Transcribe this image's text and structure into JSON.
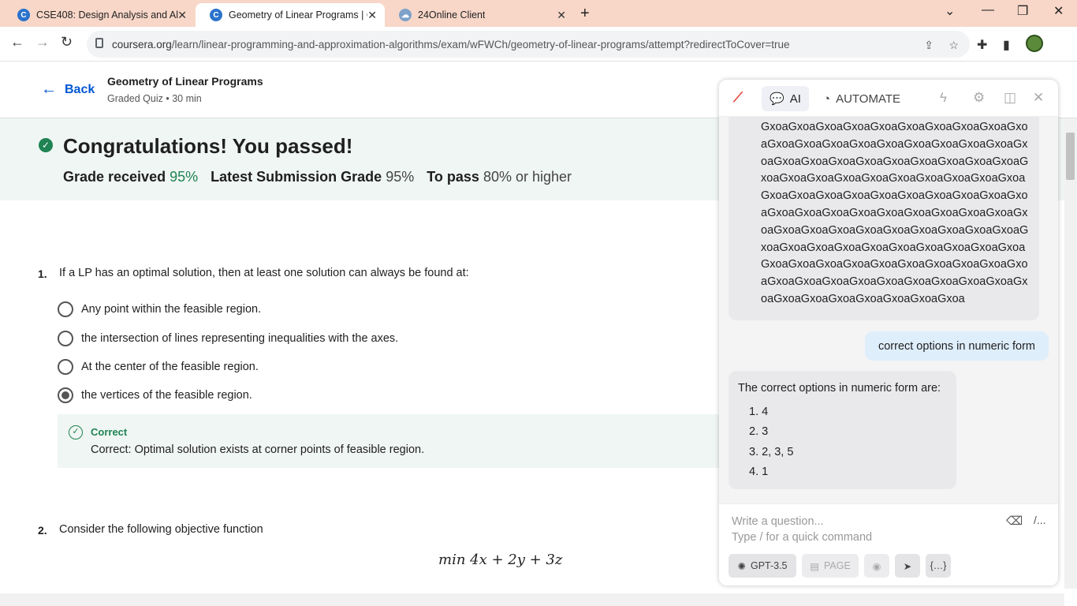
{
  "browser": {
    "tabs": [
      {
        "title": "CSE408: Design Analysis and Alg",
        "favicon": "C"
      },
      {
        "title": "Geometry of Linear Programs | C",
        "favicon": "C"
      },
      {
        "title": "24Online Client",
        "favicon": ""
      }
    ],
    "url_host": "coursera.org",
    "url_path": "/learn/linear-programming-and-approximation-algorithms/exam/wFWCh/geometry-of-linear-programs/attempt?redirectToCover=true"
  },
  "header": {
    "back_label": "Back",
    "quiz_title": "Geometry of Linear Programs",
    "quiz_subtitle": "Graded Quiz • 30 min"
  },
  "result": {
    "headline": "Congratulations! You passed!",
    "grade_label": "Grade received",
    "grade_value": "95%",
    "latest_label": "Latest Submission Grade",
    "latest_value": "95%",
    "pass_label": "To pass",
    "pass_value": "80% or higher"
  },
  "q1": {
    "number": "1.",
    "text": "If a LP has an optimal solution, then at least one solution can always be found at:",
    "options": [
      " Any point within the feasible region.",
      " the intersection of lines representing inequalities with the axes.",
      "At the center of the feasible region.",
      "the vertices of the feasible region."
    ],
    "feedback_label": "Correct",
    "feedback_text": "Correct: Optimal solution exists at corner points of feasible region."
  },
  "q2": {
    "number": "2.",
    "text": "Consider the following objective function",
    "formula": "min 4x + 2y + 3z"
  },
  "assistant": {
    "tab_ai": "AI",
    "tab_automate": "AUTOMATE",
    "garbled_text": "GxoaGxoaGxoaGxoaGxoaGxoaGxoaGxoaGxoaGxoaGxoaGxoaGxoaGxoaGxoaGxoaGxoaGxoaGxoaGxoaGxoaGxoaGxoaGxoaGxoaGxoaGxoaGxoaGxoaGxoaGxoaGxoaGxoaGxoaGxoaGxoaGxoaGxoaGxoaGxoaGxoaGxoaGxoaGxoaGxoaGxoaGxoaGxoaGxoaGxoaGxoaGxoaGxoaGxoaGxoaGxoaGxoaGxoaGxoaGxoaGxoaGxoaGxoaGxoaGxoaGxoaGxoaGxoaGxoaGxoaGxoaGxoaGxoaGxoaGxoaGxoaGxoaGxoaGxoaGxoaGxoaGxoaGxoaGxoaGxoaGxoaGxoaGxoaGxoaGxoaGxoaGxoaGxoaGxoaGxoaGxoaGxoaGxoaGxoaGxoaGxoaGxoaGxoaGxoaGxoa",
    "user_message": "correct options in numeric form",
    "answer_head": "The correct options in numeric form are:",
    "answer_items": [
      "1. 4",
      "2. 3",
      "3. 2, 3, 5",
      "4. 1"
    ],
    "input_placeholder": "Write a question...",
    "input_hint": "Type / for a quick command",
    "model_chip": "GPT-3.5",
    "page_chip": "PAGE"
  }
}
